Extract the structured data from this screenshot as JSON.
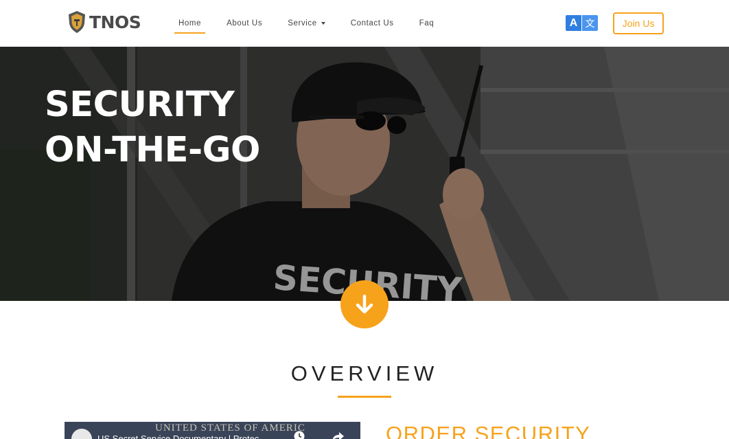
{
  "brand": {
    "name": "TNOS"
  },
  "nav": {
    "items": [
      {
        "label": "Home",
        "active": true
      },
      {
        "label": "About Us",
        "active": false
      },
      {
        "label": "Service",
        "active": false,
        "dropdown": true
      },
      {
        "label": "Contact Us",
        "active": false
      },
      {
        "label": "Faq",
        "active": false
      }
    ]
  },
  "translate": {
    "icon": "translate-icon",
    "glyph_a": "A",
    "glyph_b": "文"
  },
  "header": {
    "join_label": "Join Us"
  },
  "hero": {
    "title_line1": "SECURITY",
    "title_line2": "ON-THE-GO",
    "shirt_text": "SECURITY"
  },
  "scroll": {
    "icon": "arrow-down-icon"
  },
  "overview": {
    "title": "OVERVIEW"
  },
  "video": {
    "watermark": "UNITED STATES OF AMERIC",
    "title": "US Secret Service Documentary | Protec"
  },
  "order": {
    "title": "ORDER SECURITY"
  },
  "colors": {
    "accent": "#f7a21b",
    "translate_blue": "#2f7fe0"
  }
}
